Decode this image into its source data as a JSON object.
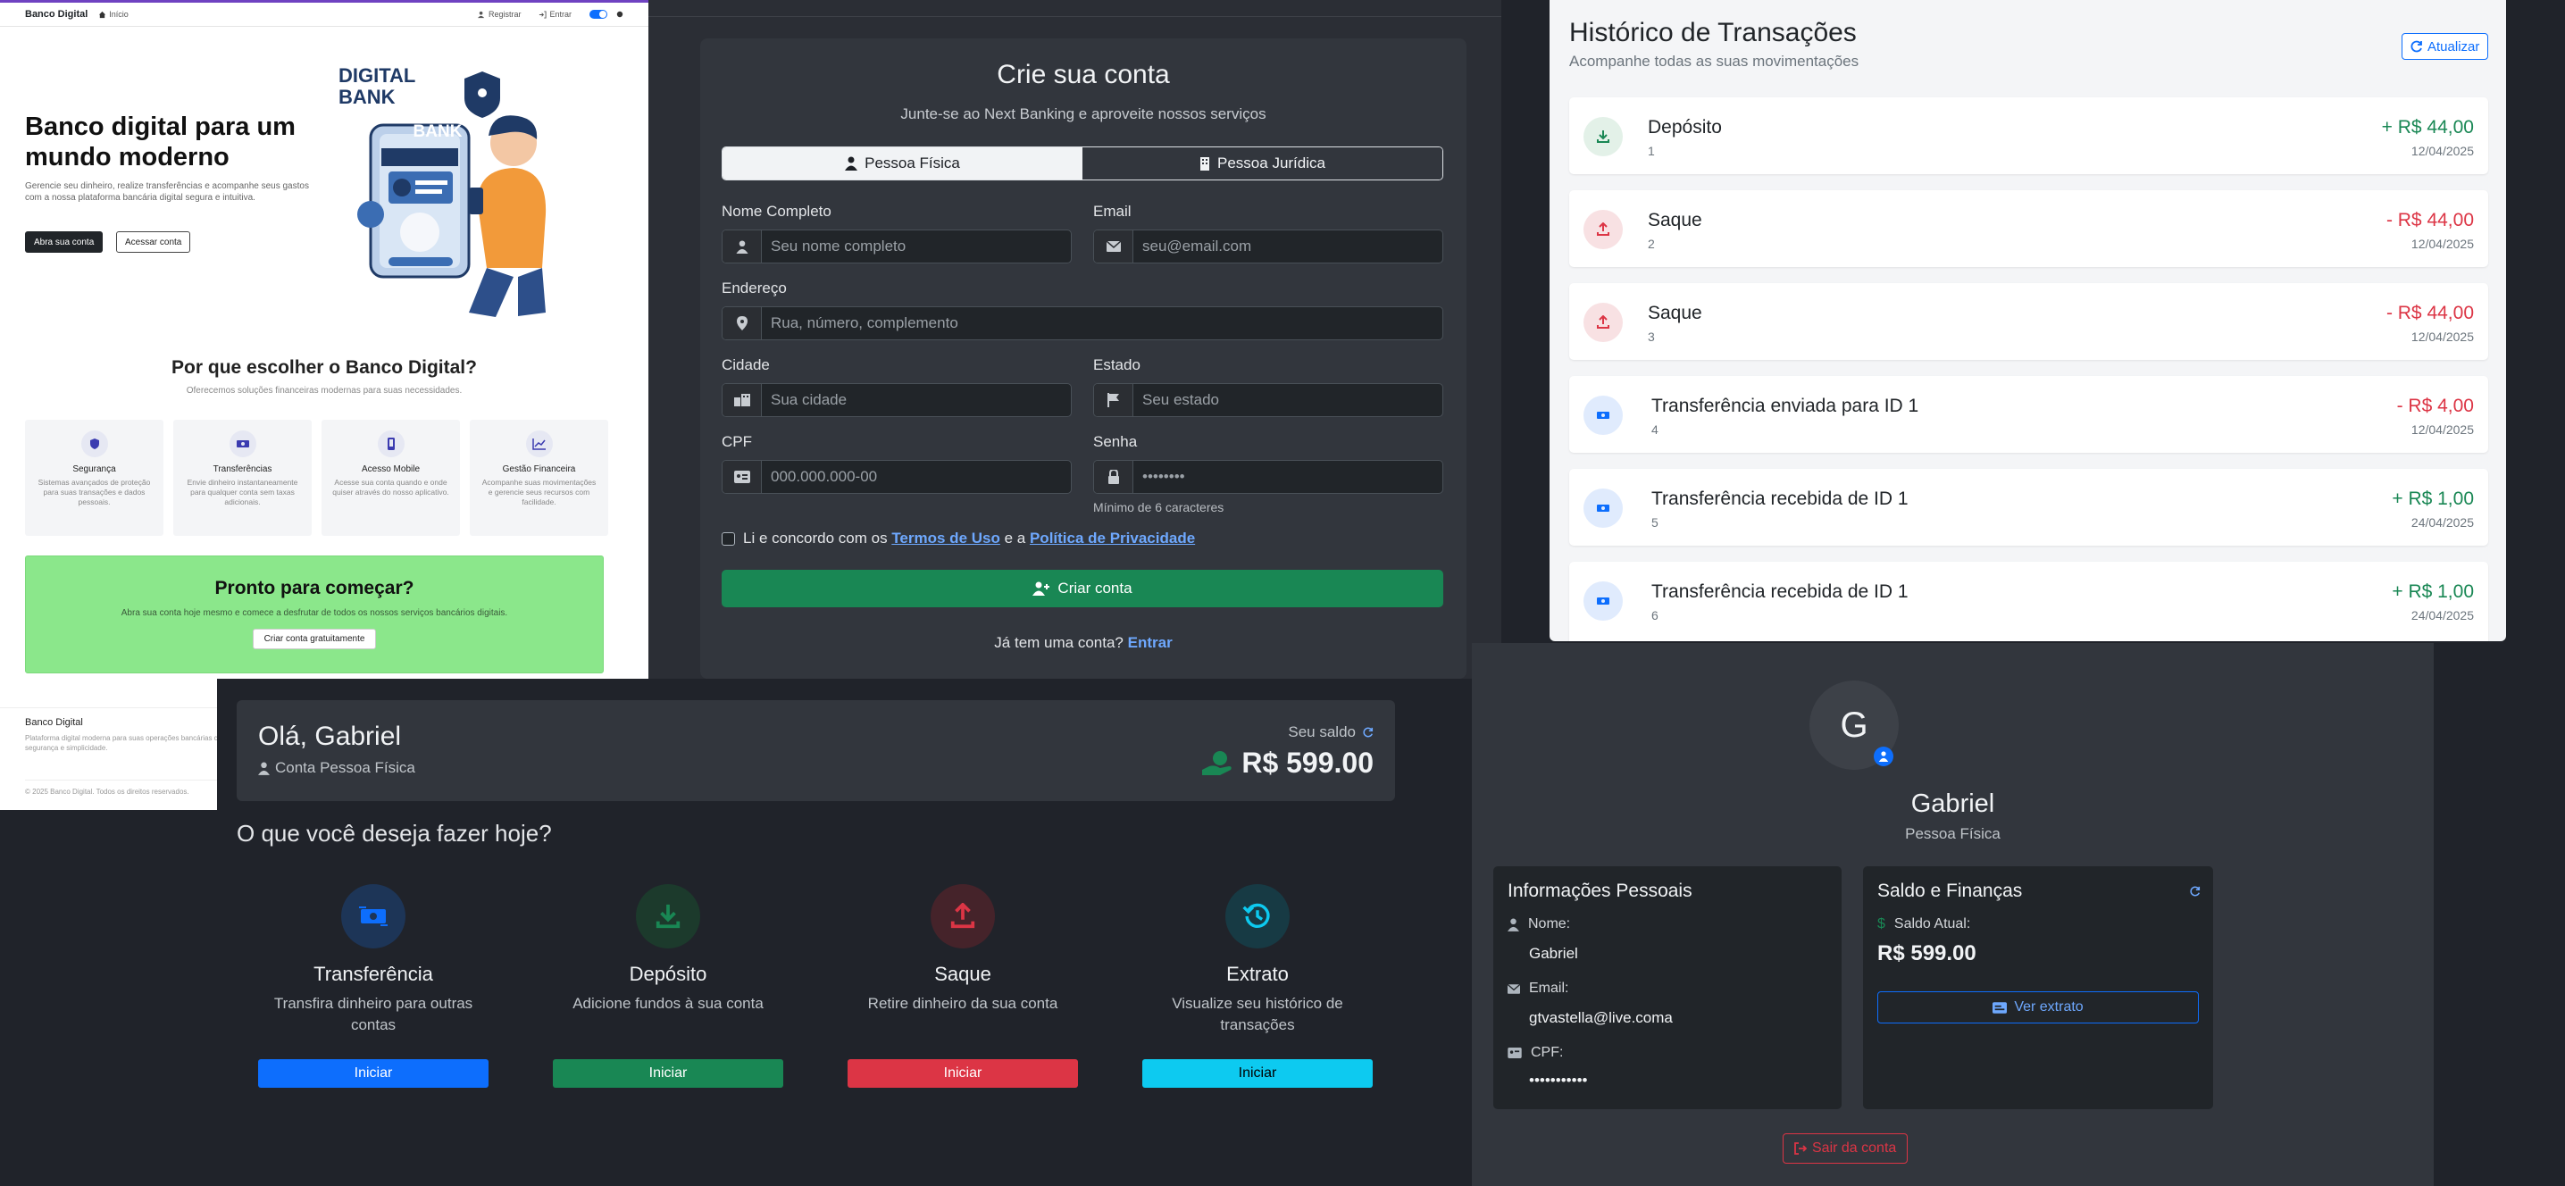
{
  "landing": {
    "nav": {
      "brand": "Banco Digital",
      "home": "Início",
      "register": "Registrar",
      "login": "Entrar"
    },
    "hero": {
      "title": "Banco digital para um mundo moderno",
      "description": "Gerencie seu dinheiro, realize transferências e acompanhe seus gastos com a nossa plataforma bancária digital segura e intuitiva.",
      "cta_primary": "Abra sua conta",
      "cta_secondary": "Acessar conta",
      "illustration_title": "DIGITAL BANK",
      "illustration_sign": "BANK"
    },
    "why": {
      "title": "Por que escolher o Banco Digital?",
      "subtitle": "Oferecemos soluções financeiras modernas para suas necessidades.",
      "features": [
        {
          "title": "Segurança",
          "desc": "Sistemas avançados de proteção para suas transações e dados pessoais."
        },
        {
          "title": "Transferências",
          "desc": "Envie dinheiro instantaneamente para qualquer conta sem taxas adicionais."
        },
        {
          "title": "Acesso Mobile",
          "desc": "Acesse sua conta quando e onde quiser através do nosso aplicativo."
        },
        {
          "title": "Gestão Financeira",
          "desc": "Acompanhe suas movimentações e gerencie seus recursos com facilidade."
        }
      ]
    },
    "cta": {
      "title": "Pronto para começar?",
      "desc": "Abra sua conta hoje mesmo e comece a desfrutar de todos os nossos serviços bancários digitais.",
      "button": "Criar conta gratuitamente"
    },
    "footer": {
      "brand": "Banco Digital",
      "desc": "Plataforma digital moderna para suas operações bancárias com segurança e simplicidade.",
      "copyright": "© 2025 Banco Digital. Todos os direitos reservados."
    }
  },
  "register": {
    "title": "Crie sua conta",
    "subtitle": "Junte-se ao Next Banking e aproveite nossos serviços",
    "tabs": {
      "pf": "Pessoa Física",
      "pj": "Pessoa Jurídica"
    },
    "fields": {
      "name": {
        "label": "Nome Completo",
        "placeholder": "Seu nome completo"
      },
      "email": {
        "label": "Email",
        "placeholder": "seu@email.com"
      },
      "address": {
        "label": "Endereço",
        "placeholder": "Rua, número, complemento"
      },
      "city": {
        "label": "Cidade",
        "placeholder": "Sua cidade"
      },
      "state": {
        "label": "Estado",
        "placeholder": "Seu estado"
      },
      "cpf": {
        "label": "CPF",
        "placeholder": "000.000.000-00"
      },
      "password": {
        "label": "Senha",
        "placeholder": "••••••••",
        "hint": "Mínimo de 6 caracteres"
      }
    },
    "terms": {
      "prefix": "Li e concordo com os ",
      "terms": "Termos de Uso",
      "mid": " e a ",
      "privacy": "Política de Privacidade"
    },
    "submit": "Criar conta",
    "login": {
      "prefix": "Já tem uma conta? ",
      "link": "Entrar"
    }
  },
  "history": {
    "title": "Histórico de Transações",
    "subtitle": "Acompanhe todas as suas movimentações",
    "refresh": "Atualizar",
    "items": [
      {
        "name": "Depósito",
        "id": "1",
        "amount": "+ R$ 44,00",
        "date": "12/04/2025",
        "kind": "in"
      },
      {
        "name": "Saque",
        "id": "2",
        "amount": "- R$ 44,00",
        "date": "12/04/2025",
        "kind": "out"
      },
      {
        "name": "Saque",
        "id": "3",
        "amount": "- R$ 44,00",
        "date": "12/04/2025",
        "kind": "out"
      },
      {
        "name": "Transferência enviada para ID 1",
        "id": "4",
        "amount": "- R$ 4,00",
        "date": "12/04/2025",
        "kind": "tout"
      },
      {
        "name": "Transferência recebida de ID 1",
        "id": "5",
        "amount": "+ R$ 1,00",
        "date": "24/04/2025",
        "kind": "tin"
      },
      {
        "name": "Transferência recebida de ID 1",
        "id": "6",
        "amount": "+ R$ 1,00",
        "date": "24/04/2025",
        "kind": "tin"
      }
    ]
  },
  "dashboard": {
    "greeting": "Olá, Gabriel",
    "account_type": "Conta Pessoa Física",
    "balance_label": "Seu saldo",
    "balance": "R$ 599.00",
    "question": "O que você deseja fazer hoje?",
    "actions": [
      {
        "title": "Transferência",
        "desc": "Transfira dinheiro para outras contas",
        "button": "Iniciar"
      },
      {
        "title": "Depósito",
        "desc": "Adicione fundos à sua conta",
        "button": "Iniciar"
      },
      {
        "title": "Saque",
        "desc": "Retire dinheiro da sua conta",
        "button": "Iniciar"
      },
      {
        "title": "Extrato",
        "desc": "Visualize seu histórico de transações",
        "button": "Iniciar"
      }
    ]
  },
  "profile": {
    "initial": "G",
    "name": "Gabriel",
    "type": "Pessoa Física",
    "personal": {
      "title": "Informações Pessoais",
      "name_label": "Nome:",
      "name": "Gabriel",
      "email_label": "Email:",
      "email": "gtvastella@live.coma",
      "cpf_label": "CPF:",
      "cpf": "•••••••••••"
    },
    "finance": {
      "title": "Saldo e Finanças",
      "balance_label": "Saldo Atual:",
      "balance": "R$ 599.00",
      "statement": "Ver extrato"
    },
    "logout": "Sair da conta"
  },
  "colors": {
    "primary": "#0d6efd",
    "success": "#198754",
    "danger": "#dc3545",
    "info": "#0dcaf0",
    "cta_bg": "#8be78b"
  }
}
